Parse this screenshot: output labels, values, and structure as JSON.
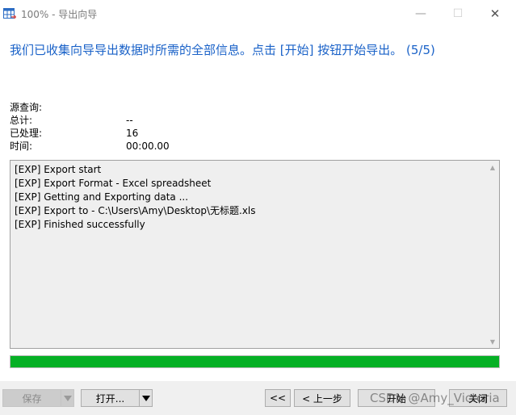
{
  "window": {
    "title": "100% - 导出向导",
    "minimize_glyph": "—",
    "maximize_glyph": "☐",
    "close_glyph": "✕"
  },
  "headline": "我们已收集向导导出数据时所需的全部信息。点击 [开始] 按钮开始导出。 (5/5)",
  "info": {
    "source_query_label": "源查询:",
    "total_label": "总计:",
    "total_value": "--",
    "processed_label": "已处理:",
    "processed_value": "16",
    "time_label": "时间:",
    "time_value": "00:00.00"
  },
  "log": {
    "lines": [
      "[EXP] Export start",
      "[EXP] Export Format - Excel spreadsheet",
      "[EXP] Getting and Exporting data ...",
      "[EXP] Export to - C:\\Users\\Amy\\Desktop\\无标题.xls",
      "[EXP] Finished successfully"
    ]
  },
  "progress": {
    "fraction": 1.0,
    "color": "#06b025"
  },
  "buttons": {
    "save": "保存",
    "open": "打开...",
    "first": "<<",
    "prev": "< 上一步",
    "start": "开始",
    "close": "关闭"
  },
  "watermark": "CSDN @Amy_Victoria",
  "colors": {
    "accent": "#1a62c8"
  },
  "icons": {
    "app": "table-export-icon"
  }
}
